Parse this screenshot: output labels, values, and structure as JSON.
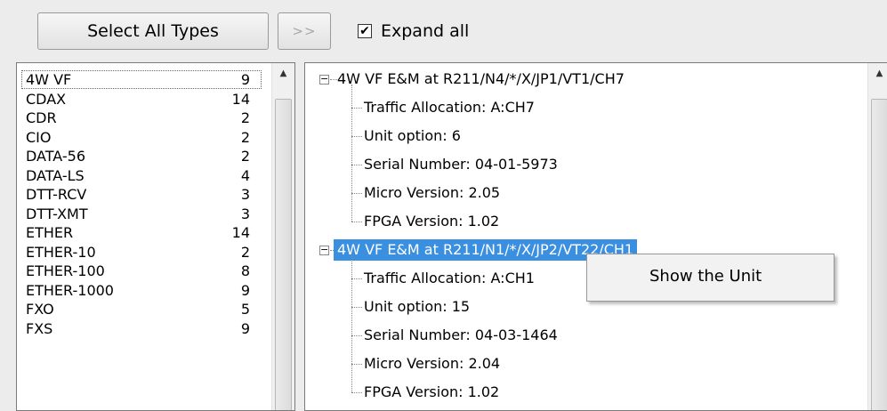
{
  "toolbar": {
    "select_all_label": "Select All Types",
    "move_label": ">>",
    "expand_all_label": "Expand all",
    "expand_all_checked": "✔"
  },
  "type_list": [
    {
      "name": "4W VF",
      "count": "9"
    },
    {
      "name": "CDAX",
      "count": "14"
    },
    {
      "name": "CDR",
      "count": "2"
    },
    {
      "name": "CIO",
      "count": "2"
    },
    {
      "name": "DATA-56",
      "count": "2"
    },
    {
      "name": "DATA-LS",
      "count": "4"
    },
    {
      "name": "DTT-RCV",
      "count": "3"
    },
    {
      "name": "DTT-XMT",
      "count": "3"
    },
    {
      "name": "ETHER",
      "count": "14"
    },
    {
      "name": "ETHER-10",
      "count": "2"
    },
    {
      "name": "ETHER-100",
      "count": "8"
    },
    {
      "name": "ETHER-1000",
      "count": "9"
    },
    {
      "name": "FXO",
      "count": "5"
    },
    {
      "name": "FXS",
      "count": "9"
    }
  ],
  "tree": {
    "nodes": [
      {
        "label": "4W VF E&M at R211/N4/*/X/JP1/VT1/CH7",
        "children": [
          "Traffic Allocation: A:CH7",
          "Unit option: 6",
          "Serial Number: 04-01-5973",
          "Micro Version: 2.05",
          "FPGA Version: 1.02"
        ]
      },
      {
        "label": "4W VF E&M at R211/N1/*/X/JP2/VT22/CH1",
        "children": [
          "Traffic Allocation: A:CH1",
          "Unit option: 15",
          "Serial Number: 04-03-1464",
          "Micro Version: 2.04",
          "FPGA Version: 1.02"
        ]
      }
    ]
  },
  "context_menu": {
    "item": "Show the Unit"
  },
  "icons": {
    "expander": "minus-box-icon",
    "scroll_up": "up-arrow-icon"
  },
  "colors": {
    "selection": "#3a8fe0",
    "background": "#ececec"
  }
}
